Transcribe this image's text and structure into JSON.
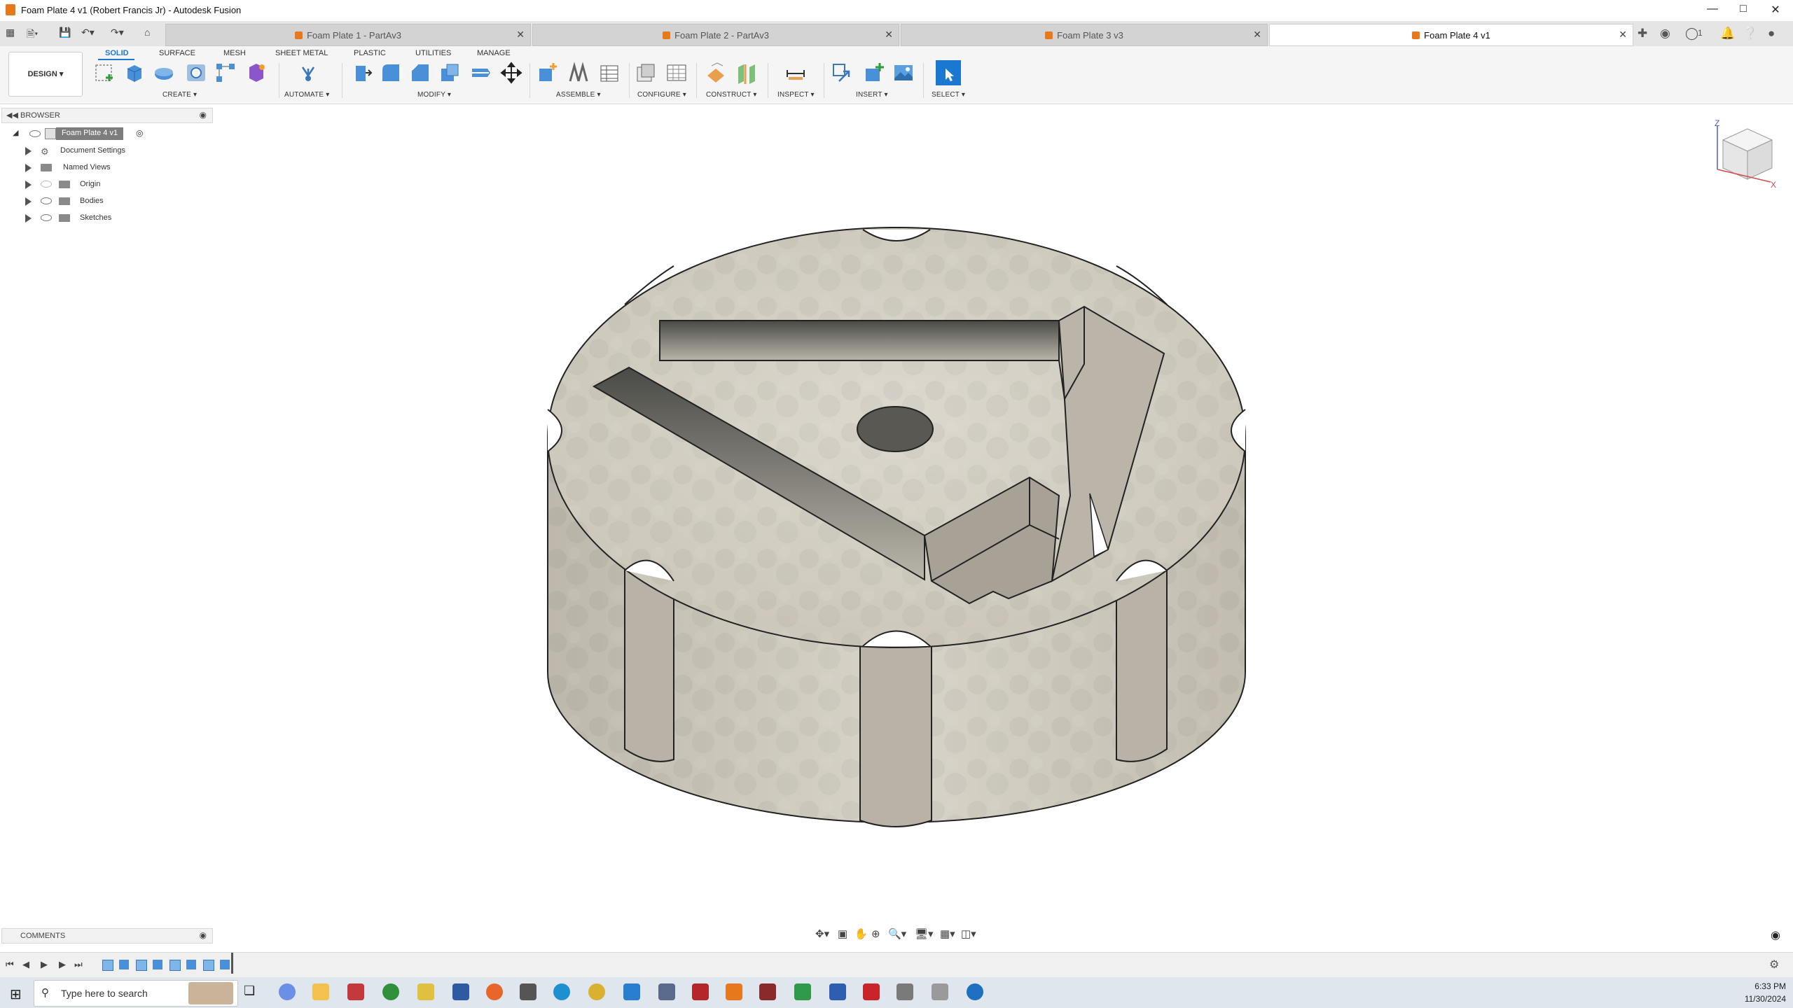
{
  "window": {
    "title": "Foam Plate 4 v1 (Robert Francis Jr) - Autodesk Fusion"
  },
  "tabs": [
    {
      "label": "Foam Plate 1 - PartAv3",
      "active": false
    },
    {
      "label": "Foam Plate 2 - PartAv3",
      "active": false
    },
    {
      "label": "Foam Plate 3 v3",
      "active": false
    },
    {
      "label": "Foam Plate 4 v1",
      "active": true
    }
  ],
  "notifications_count": "1",
  "ribbon": {
    "workspace": "DESIGN",
    "tabs": [
      "SOLID",
      "SURFACE",
      "MESH",
      "SHEET METAL",
      "PLASTIC",
      "UTILITIES",
      "MANAGE"
    ],
    "active_tab": "SOLID",
    "groups": [
      "CREATE",
      "AUTOMATE",
      "MODIFY",
      "ASSEMBLE",
      "CONFIGURE",
      "CONSTRUCT",
      "INSPECT",
      "INSERT",
      "SELECT"
    ]
  },
  "browser": {
    "title": "BROWSER",
    "root": "Foam Plate 4 v1",
    "items": [
      {
        "label": "Document Settings",
        "icon": "gear-icon"
      },
      {
        "label": "Named Views",
        "icon": "folder-icon"
      },
      {
        "label": "Origin",
        "icon": "folder-icon"
      },
      {
        "label": "Bodies",
        "icon": "folder-icon"
      },
      {
        "label": "Sketches",
        "icon": "folder-icon"
      }
    ]
  },
  "comments": {
    "title": "COMMENTS"
  },
  "viewcube": {
    "axes": [
      "Z",
      "X"
    ]
  },
  "taskbar": {
    "search_placeholder": "Type here to search",
    "time": "6:33 PM",
    "date": "11/30/2024"
  },
  "colors": {
    "accent": "#1b78d0",
    "model_face": "#d6d2c7",
    "model_wall": "#cfcbbf"
  }
}
